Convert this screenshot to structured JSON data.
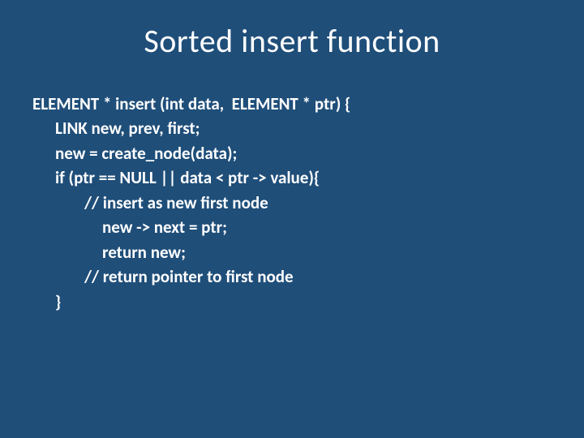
{
  "slide": {
    "title": "Sorted insert  function",
    "code": {
      "l1": "ELEMENT * insert (int data,  ELEMENT * ptr) {",
      "l2": "LINK new, prev, first;",
      "l3": "new = create_node(data);",
      "l4": "if (ptr == NULL || data < ptr -> value){",
      "l5": "// insert as new first node",
      "l6": "new -> next = ptr;",
      "l7": "return new;",
      "l8": "// return pointer to first node",
      "l9": "}"
    }
  }
}
